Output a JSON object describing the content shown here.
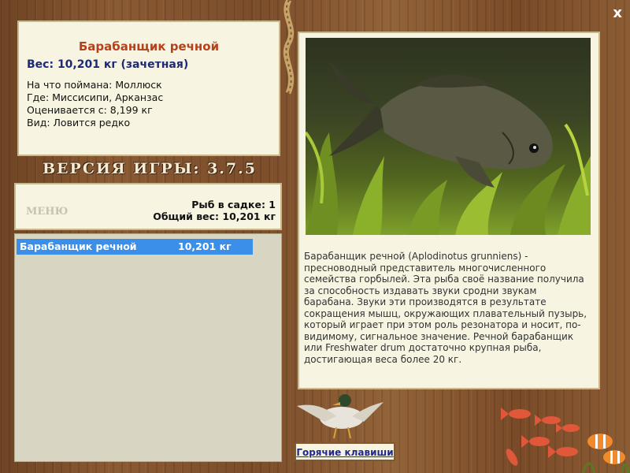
{
  "window": {
    "close_label": "x"
  },
  "fish_info": {
    "name": "Барабанщик речной",
    "weight_line": "Вес: 10,201 кг (зачетная)",
    "caught_on": "На что поймана: Моллюск",
    "location": "Где: Миссисипи, Арканзас",
    "rated_from": "Оценивается с: 8,199 кг",
    "kind": "Вид: Ловится редко"
  },
  "version": "ВЕРСИЯ ИГРЫ: 3.7.5",
  "menu": {
    "label": "МЕНЮ",
    "fish_in_cage": "Рыб в садке: 1",
    "total_weight": "Общий вес: 10,201 кг"
  },
  "catch_list": [
    {
      "name": "Барабанщик речной",
      "weight": "10,201 кг"
    }
  ],
  "description": "Барабанщик речной (Aplodinotus grunniens) - пресноводный представитель многочисленного семейства горбылей. Эта рыба своё название получила за способность издавать звуки сродни звукам барабана. Звуки эти производятся в результате сокращения мышц, окружающих плавательный пузырь, который играет при этом роль резонатора и носит, по-видимому, сигнальное значение. Речной барабанщик или Freshwater drum достаточно крупная рыба, достигающая веса более 20 кг.",
  "hotkeys_label": "Горячие клавиши",
  "colors": {
    "title": "#b5421a",
    "weight": "#1c2a78",
    "selection": "#3b8fe8",
    "panel": "#f7f4e2"
  }
}
